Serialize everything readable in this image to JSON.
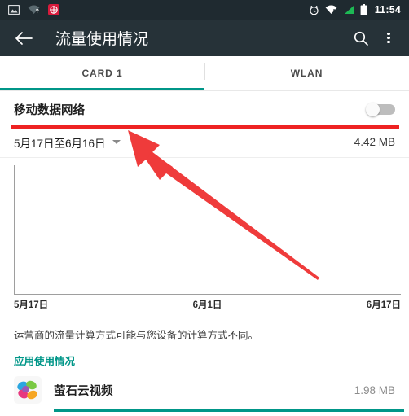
{
  "statusbar": {
    "left_icons": [
      "screenshot-icon",
      "wifi-question-icon",
      "red-badge-icon"
    ],
    "right_icons": [
      "alarm-icon",
      "wifi-alert-icon",
      "signal-icon",
      "battery-icon"
    ],
    "time": "11:54"
  },
  "toolbar": {
    "back_label": "←",
    "title": "流量使用情况",
    "search_name": "search-icon",
    "overflow_name": "overflow-menu-icon"
  },
  "tabs": [
    {
      "label": "CARD 1",
      "active": true
    },
    {
      "label": "WLAN",
      "active": false
    }
  ],
  "mobile_data": {
    "label": "移动数据网络",
    "enabled": false
  },
  "date_range": {
    "label": "5月17日至6月16日",
    "total": "4.42 MB"
  },
  "chart_data": {
    "type": "bar",
    "title": "",
    "categories": [
      "5月17日",
      "6月1日",
      "6月17日"
    ],
    "values": [
      0,
      0,
      0
    ],
    "xlabel": "",
    "ylabel": "",
    "ylim": [
      0,
      1
    ],
    "grid": false,
    "note": "empty-usage-chart"
  },
  "footnote": "运营商的流量计算方式可能与您设备的计算方式不同。",
  "app_section": {
    "heading": "应用使用情况",
    "apps": [
      {
        "name": "萤石云视频",
        "size": "1.98 MB",
        "bar_percent": 100,
        "icon": "ezviz-pinwheel-icon"
      }
    ]
  },
  "annotations": {
    "underline_color": "#ee2222",
    "arrow_color": "#ef3b3b",
    "arrow_target": "移动数据网络"
  },
  "colors": {
    "toolbar": "#263238",
    "statusbar": "#1f2a30",
    "accent": "#009688"
  }
}
